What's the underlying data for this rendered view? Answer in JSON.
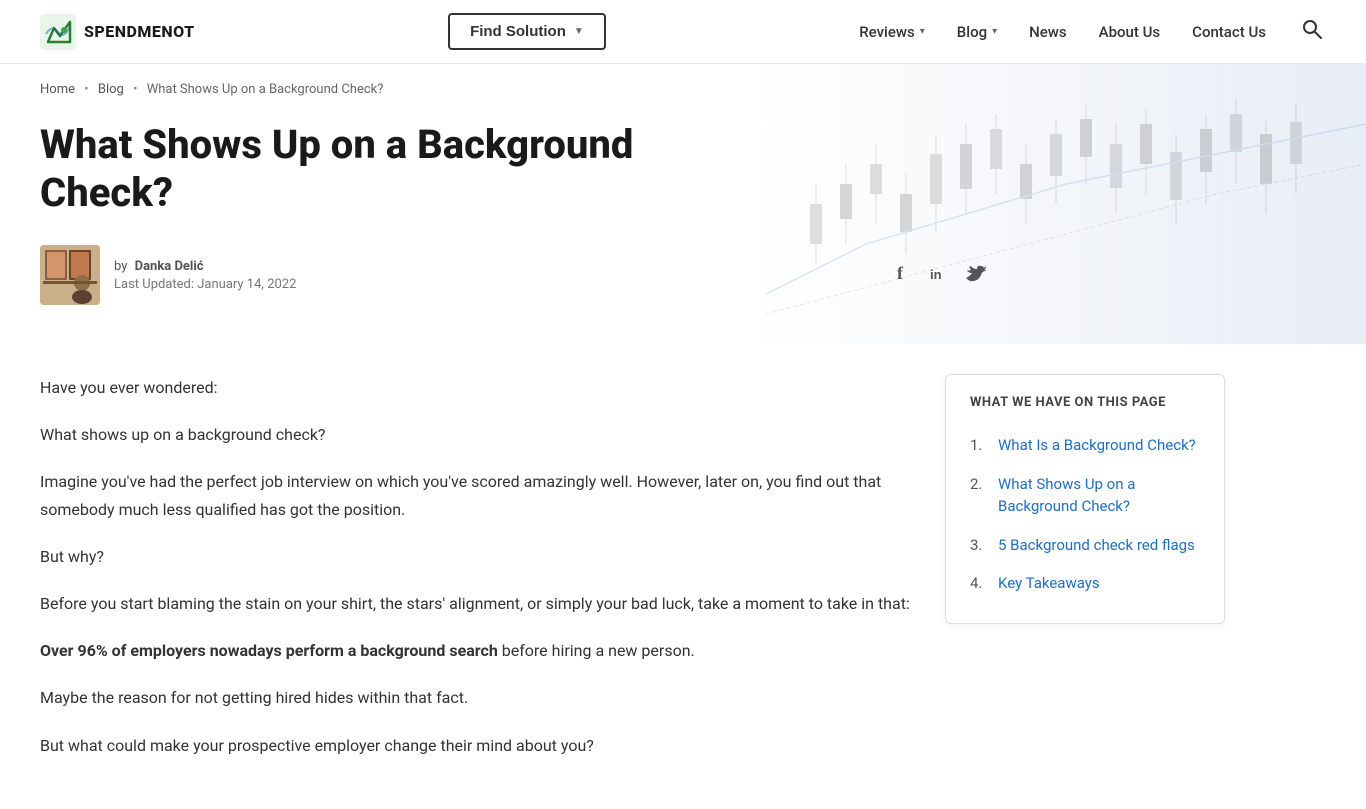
{
  "header": {
    "logo_text": "SPENDMENOT",
    "find_solution_label": "Find Solution",
    "nav_items": [
      {
        "label": "Reviews",
        "has_dropdown": true
      },
      {
        "label": "Blog",
        "has_dropdown": true
      },
      {
        "label": "News",
        "has_dropdown": false
      },
      {
        "label": "About Us",
        "has_dropdown": false
      },
      {
        "label": "Contact Us",
        "has_dropdown": false
      }
    ]
  },
  "breadcrumb": {
    "home": "Home",
    "blog": "Blog",
    "current": "What Shows Up on a Background Check?"
  },
  "article": {
    "title": "What Shows Up on a Background Check?",
    "author_by": "by",
    "author_name": "Danka Delić",
    "author_date": "Last Updated: January 14, 2022",
    "paragraphs": [
      "Have you ever wondered:",
      "What shows up on a background check?",
      "Imagine you've had the perfect job interview on which you've scored amazingly well. However, later on, you find out that somebody much less qualified has got the position.",
      "But why?",
      "Before you start blaming the stain on your shirt, the stars' alignment, or simply your bad luck, take a moment to take in that:",
      "before hiring a new person.",
      "Maybe the reason for not getting hired hides within that fact.",
      "But what could make your prospective employer change their mind about you?"
    ],
    "bold_text": "Over 96% of employers nowadays perform a background search"
  },
  "toc": {
    "title": "WHAT WE HAVE ON THIS PAGE",
    "items": [
      {
        "num": "1.",
        "label": "What Is a Background Check?"
      },
      {
        "num": "2.",
        "label": "What Shows Up on a Background Check?"
      },
      {
        "num": "3.",
        "label": "5 Background check red flags"
      },
      {
        "num": "4.",
        "label": "Key Takeaways"
      }
    ]
  },
  "social": {
    "facebook_icon": "f",
    "linkedin_icon": "in",
    "twitter_icon": "t"
  }
}
